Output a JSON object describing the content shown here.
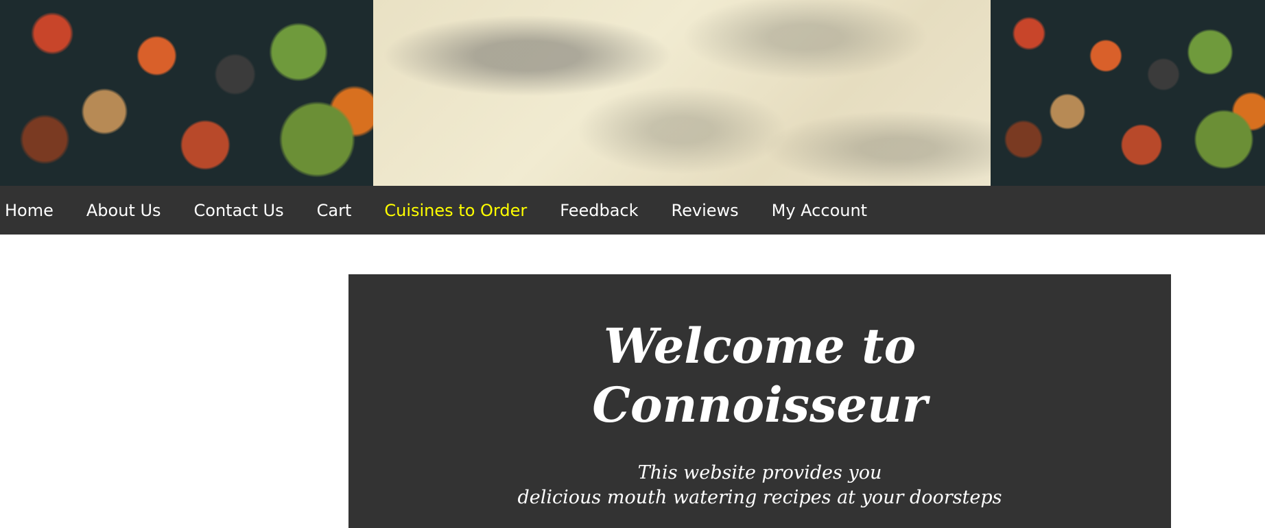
{
  "nav": {
    "items": [
      {
        "label": "Home"
      },
      {
        "label": "About Us"
      },
      {
        "label": "Contact Us"
      },
      {
        "label": "Cart"
      },
      {
        "label": "Cuisines to Order",
        "active": true
      },
      {
        "label": "Feedback"
      },
      {
        "label": "Reviews"
      },
      {
        "label": "My Account"
      }
    ],
    "active_color": "#ffff00",
    "background": "#333333"
  },
  "welcome": {
    "title": "Welcome to Connoisseur",
    "subtitle_line1": "This website provides you",
    "subtitle_line2": "delicious mouth watering recipes at your doorsteps"
  }
}
